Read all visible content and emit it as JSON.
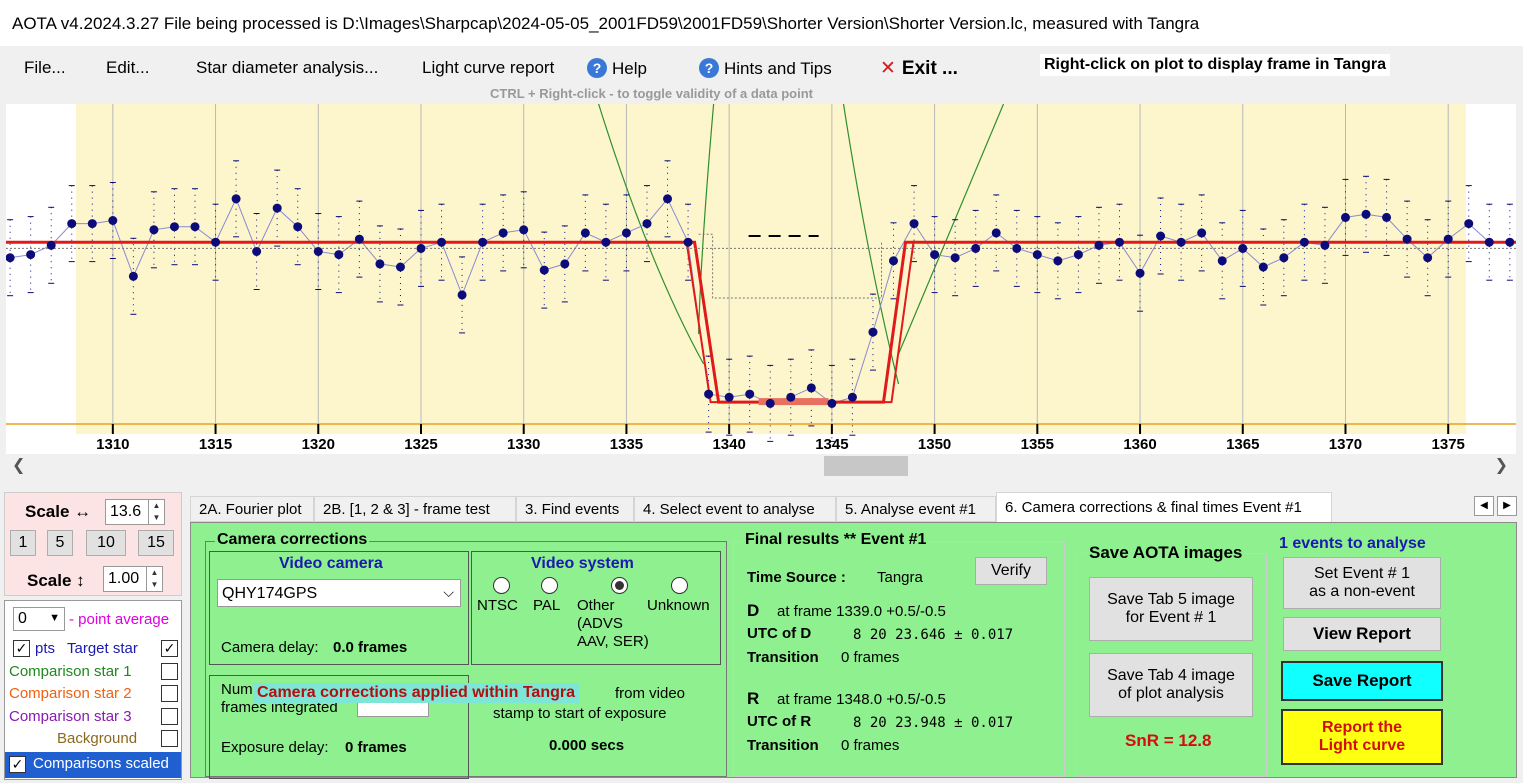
{
  "window": {
    "title": "AOTA v4.2024.3.27     File being processed is D:\\Images\\Sharpcap\\2024-05-05_2001FD59\\2001FD59\\Shorter Version\\Shorter Version.lc, measured with Tangra"
  },
  "menu": {
    "file": "File...",
    "edit": "Edit...",
    "star_diameter": "Star diameter analysis...",
    "light_curve_report": "Light curve report",
    "help": "Help",
    "hints": "Hints and Tips",
    "exit": "Exit ...",
    "right_click_hint": "Right-click on plot to display frame in Tangra",
    "ctrl_hint": "CTRL + Right-click  -  to toggle validity of a data point"
  },
  "colors": {
    "plot_bg": "#fdf6cc",
    "model_line": "#e01a1a",
    "data_points": "#0b0b7a",
    "envelope": "#2f8f2f"
  },
  "chart_data": {
    "type": "scatter",
    "xlabel": "",
    "ylabel": "",
    "x_ticks": [
      1310,
      1315,
      1320,
      1325,
      1330,
      1335,
      1340,
      1345,
      1350,
      1355,
      1360,
      1365,
      1370,
      1375
    ],
    "xlim": [
      1304.8,
      1378.3
    ],
    "ylim": [
      0,
      1
    ],
    "x": [
      1305,
      1306,
      1307,
      1308,
      1309,
      1310,
      1311,
      1312,
      1313,
      1314,
      1315,
      1316,
      1317,
      1318,
      1319,
      1320,
      1321,
      1322,
      1323,
      1324,
      1325,
      1326,
      1327,
      1328,
      1329,
      1330,
      1331,
      1332,
      1333,
      1334,
      1335,
      1336,
      1337,
      1338,
      1339,
      1340,
      1341,
      1342,
      1343,
      1344,
      1345,
      1346,
      1347,
      1348,
      1349,
      1350,
      1351,
      1352,
      1353,
      1354,
      1355,
      1356,
      1357,
      1358,
      1359,
      1360,
      1361,
      1362,
      1363,
      1364,
      1365,
      1366,
      1367,
      1368,
      1369,
      1370,
      1371,
      1372,
      1373,
      1374,
      1375,
      1376,
      1377,
      1378
    ],
    "y": [
      0.53,
      0.54,
      0.57,
      0.64,
      0.64,
      0.65,
      0.47,
      0.62,
      0.63,
      0.63,
      0.58,
      0.72,
      0.55,
      0.69,
      0.63,
      0.55,
      0.54,
      0.59,
      0.51,
      0.5,
      0.56,
      0.58,
      0.41,
      0.58,
      0.61,
      0.62,
      0.49,
      0.51,
      0.61,
      0.58,
      0.61,
      0.64,
      0.72,
      0.58,
      0.09,
      0.08,
      0.09,
      0.06,
      0.08,
      0.11,
      0.06,
      0.08,
      0.29,
      0.52,
      0.64,
      0.54,
      0.53,
      0.56,
      0.61,
      0.56,
      0.54,
      0.52,
      0.54,
      0.57,
      0.58,
      0.48,
      0.6,
      0.58,
      0.61,
      0.52,
      0.56,
      0.5,
      0.53,
      0.58,
      0.57,
      0.66,
      0.67,
      0.66,
      0.59,
      0.53,
      0.59,
      0.64,
      0.58,
      0.58
    ],
    "model_line": {
      "baseline": 0.58,
      "bottom": 0.09,
      "d_frame": 1339.0,
      "r_frame": 1348.0
    }
  },
  "scale": {
    "h_label": "Scale ↔",
    "h_value": "13.6",
    "presets": [
      "1",
      "5",
      "10",
      "15"
    ],
    "v_label": "Scale ↕",
    "v_value": "1.00"
  },
  "series": {
    "point_avg_value": "0",
    "point_avg_label": "- point average",
    "pts_label": "pts",
    "target": "Target star",
    "comp1": "Comparison star 1",
    "comp2": "Comparison star 2",
    "comp3": "Comparison star 3",
    "background": "Background",
    "comps_scaled": "Comparisons scaled"
  },
  "tabs": [
    "2A. Fourier plot",
    "2B. [1, 2 & 3] - frame test",
    "3. Find events",
    "4. Select event to analyse",
    "5. Analyse event #1",
    "6. Camera corrections & final times Event #1"
  ],
  "camera": {
    "group_title": "Camera corrections",
    "video_camera_title": "Video camera",
    "camera_value": "QHY174GPS",
    "camera_delay_label": "Camera delay:",
    "camera_delay_value": "0.0 frames",
    "video_system_title": "Video system",
    "opt_ntsc": "NTSC",
    "opt_pal": "PAL",
    "opt_other": "Other",
    "opt_other_sub1": "(ADVS",
    "opt_other_sub2": "AAV, SER)",
    "opt_unknown": "Unknown",
    "frames_integrated_1": "Num",
    "frames_integrated_2": "frames integrated",
    "tangra_banner": "Camera corrections applied within Tangra",
    "from_video_1": "from video",
    "from_video_2": "stamp to start of exposure",
    "exposure_delay_label": "Exposure delay:",
    "exposure_delay_value": "0 frames",
    "secs_value": "0.000 secs"
  },
  "results": {
    "title": "Final results  **  Event #1",
    "time_source_label": "Time Source :",
    "time_source_value": "Tangra",
    "verify": "Verify",
    "d_label": "D",
    "d_frame": "at frame 1339.0  +0.5/-0.5",
    "utc_d_label": "UTC of D",
    "utc_d_value": "8 20 23.646 ± 0.017",
    "transition_label": "Transition",
    "transition_d_value": "0 frames",
    "r_label": "R",
    "r_frame": "at frame 1348.0  +0.5/-0.5",
    "utc_r_label": "UTC of R",
    "utc_r_value": "8 20 23.948 ± 0.017",
    "transition_r_value": "0 frames"
  },
  "save_images": {
    "title": "Save AOTA images",
    "tab5_l1": "Save Tab 5 image",
    "tab5_l2": "for Event # 1",
    "tab4_l1": "Save Tab 4 image",
    "tab4_l2": "of plot analysis",
    "snr": "SnR = 12.8"
  },
  "right": {
    "events_count": "1  events to analyse",
    "non_event_l1": "Set Event # 1",
    "non_event_l2": "as a non-event",
    "view_report": "View Report",
    "save_report": "Save Report",
    "report_l1": "Report the",
    "report_l2": "Light curve"
  }
}
